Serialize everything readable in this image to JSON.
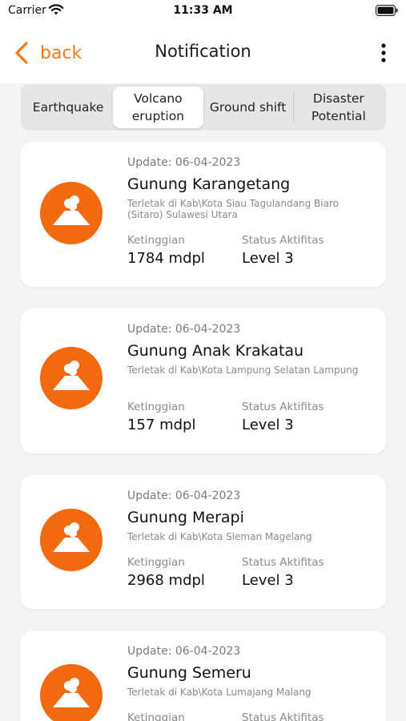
{
  "status_bar": {
    "carrier": "Carrier",
    "time": "11:33 AM"
  },
  "nav": {
    "back_label": "back",
    "title": "Notification"
  },
  "tabs": [
    {
      "label": "Earthquake",
      "active": false
    },
    {
      "label": "Volcano eruption",
      "active": true
    },
    {
      "label": "Ground shift",
      "active": false
    },
    {
      "label": "Disaster Potential",
      "active": false
    }
  ],
  "labels": {
    "elevation": "Ketinggian",
    "status": "Status Aktifitas"
  },
  "notifications": [
    {
      "update": "Update: 06-04-2023",
      "name": "Gunung Karangetang",
      "location": "Terletak di Kab\\Kota Siau Tagulandang Biaro (Sitaro) Sulawesi Utara",
      "elevation": "1784 mdpl",
      "status": "Level 3"
    },
    {
      "update": "Update: 06-04-2023",
      "name": "Gunung Anak Krakatau",
      "location": "Terletak di Kab\\Kota Lampung Selatan Lampung",
      "elevation": "157 mdpl",
      "status": "Level 3"
    },
    {
      "update": "Update: 06-04-2023",
      "name": "Gunung Merapi",
      "location": "Terletak di Kab\\Kota Sleman Magelang",
      "elevation": "2968 mdpl",
      "status": "Level 3"
    },
    {
      "update": "Update: 06-04-2023",
      "name": "Gunung Semeru",
      "location": "Terletak di Kab\\Kota Lumajang Malang",
      "elevation": "",
      "status": ""
    }
  ],
  "colors": {
    "accent": "#f07a1a",
    "avatar": "#f26a0f",
    "background": "#f4f4f4"
  },
  "icons": {
    "back": "chevron-left-icon",
    "more": "more-vertical-icon",
    "volcano": "volcano-icon"
  }
}
